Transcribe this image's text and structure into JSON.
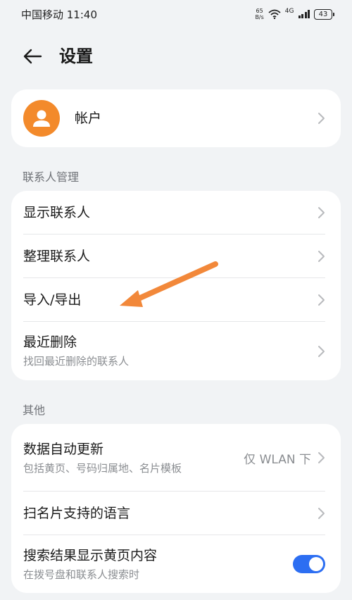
{
  "status_bar": {
    "carrier_time": "中国移动 11:40",
    "net_speed_value": "65",
    "net_speed_unit": "B/s",
    "network_type": "4G",
    "battery": "43"
  },
  "header": {
    "title": "设置"
  },
  "account": {
    "label": "帐户"
  },
  "sections": {
    "contacts": {
      "header": "联系人管理",
      "items": [
        {
          "title": "显示联系人"
        },
        {
          "title": "整理联系人"
        },
        {
          "title": "导入/导出"
        },
        {
          "title": "最近删除",
          "subtitle": "找回最近删除的联系人"
        }
      ]
    },
    "other": {
      "header": "其他",
      "items": [
        {
          "title": "数据自动更新",
          "subtitle": "包括黄页、号码归属地、名片模板",
          "value": "仅 WLAN 下"
        },
        {
          "title": "扫名片支持的语言"
        },
        {
          "title": "搜索结果显示黄页内容",
          "subtitle": "在拨号盘和联系人搜索时",
          "toggle_on": true
        }
      ]
    }
  },
  "colors": {
    "avatar": "#f38a2b",
    "toggle_on": "#2c6ef2",
    "annotation_arrow": "#f2883a"
  }
}
